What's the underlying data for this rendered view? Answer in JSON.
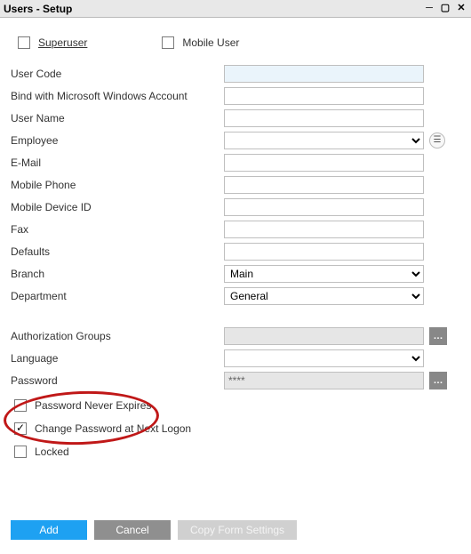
{
  "window": {
    "title": "Users - Setup"
  },
  "topChecks": {
    "superuser": "Superuser",
    "mobileUser": "Mobile User"
  },
  "fields": {
    "userCode": {
      "label": "User Code",
      "value": ""
    },
    "bindWin": {
      "label": "Bind with Microsoft Windows Account",
      "value": ""
    },
    "userName": {
      "label": "User Name",
      "value": ""
    },
    "employee": {
      "label": "Employee",
      "value": ""
    },
    "email": {
      "label": "E-Mail",
      "value": ""
    },
    "mobilePhone": {
      "label": "Mobile Phone",
      "value": ""
    },
    "mobileDeviceId": {
      "label": "Mobile Device ID",
      "value": ""
    },
    "fax": {
      "label": "Fax",
      "value": ""
    },
    "defaults": {
      "label": "Defaults",
      "value": ""
    },
    "branch": {
      "label": "Branch",
      "value": "Main",
      "options": [
        "Main"
      ]
    },
    "department": {
      "label": "Department",
      "value": "General",
      "options": [
        "General"
      ]
    },
    "authGroups": {
      "label": "Authorization Groups",
      "value": ""
    },
    "language": {
      "label": "Language",
      "value": ""
    },
    "password": {
      "label": "Password",
      "value": "****"
    }
  },
  "pwdOpts": {
    "neverExpires": {
      "label": "Password Never Expires",
      "checked": false
    },
    "changeNext": {
      "label": "Change Password at Next Logon",
      "checked": true
    },
    "locked": {
      "label": "Locked",
      "checked": false
    }
  },
  "buttons": {
    "add": "Add",
    "cancel": "Cancel",
    "copyForm": "Copy Form Settings"
  }
}
